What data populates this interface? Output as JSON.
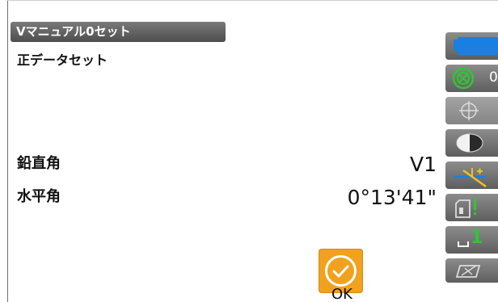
{
  "header": {
    "title": "Vマニュアル0セット",
    "subtitle": "正データセット"
  },
  "rows": [
    {
      "label": "鉛直角",
      "value": "V1"
    },
    {
      "label": "水平角",
      "value": "0°13'41\""
    }
  ],
  "ok_button": {
    "label": "OK",
    "color": "#f0a21e"
  },
  "sidebar": {
    "buttons": [
      {
        "icon": "battery-icon",
        "color": "#1a7fe0"
      },
      {
        "icon": "target-prism-icon",
        "text": "0",
        "color": "#2dc832"
      },
      {
        "icon": "crosshair-icon"
      },
      {
        "icon": "face-left-icon"
      },
      {
        "icon": "tilt-compensation-icon",
        "color": "#f0c020"
      },
      {
        "icon": "sd-card-icon",
        "color": "#2dc832"
      },
      {
        "icon": "keyboard-mode-icon",
        "text": "1",
        "color": "#2dc832"
      },
      {
        "icon": "survey-mode-icon"
      }
    ]
  }
}
